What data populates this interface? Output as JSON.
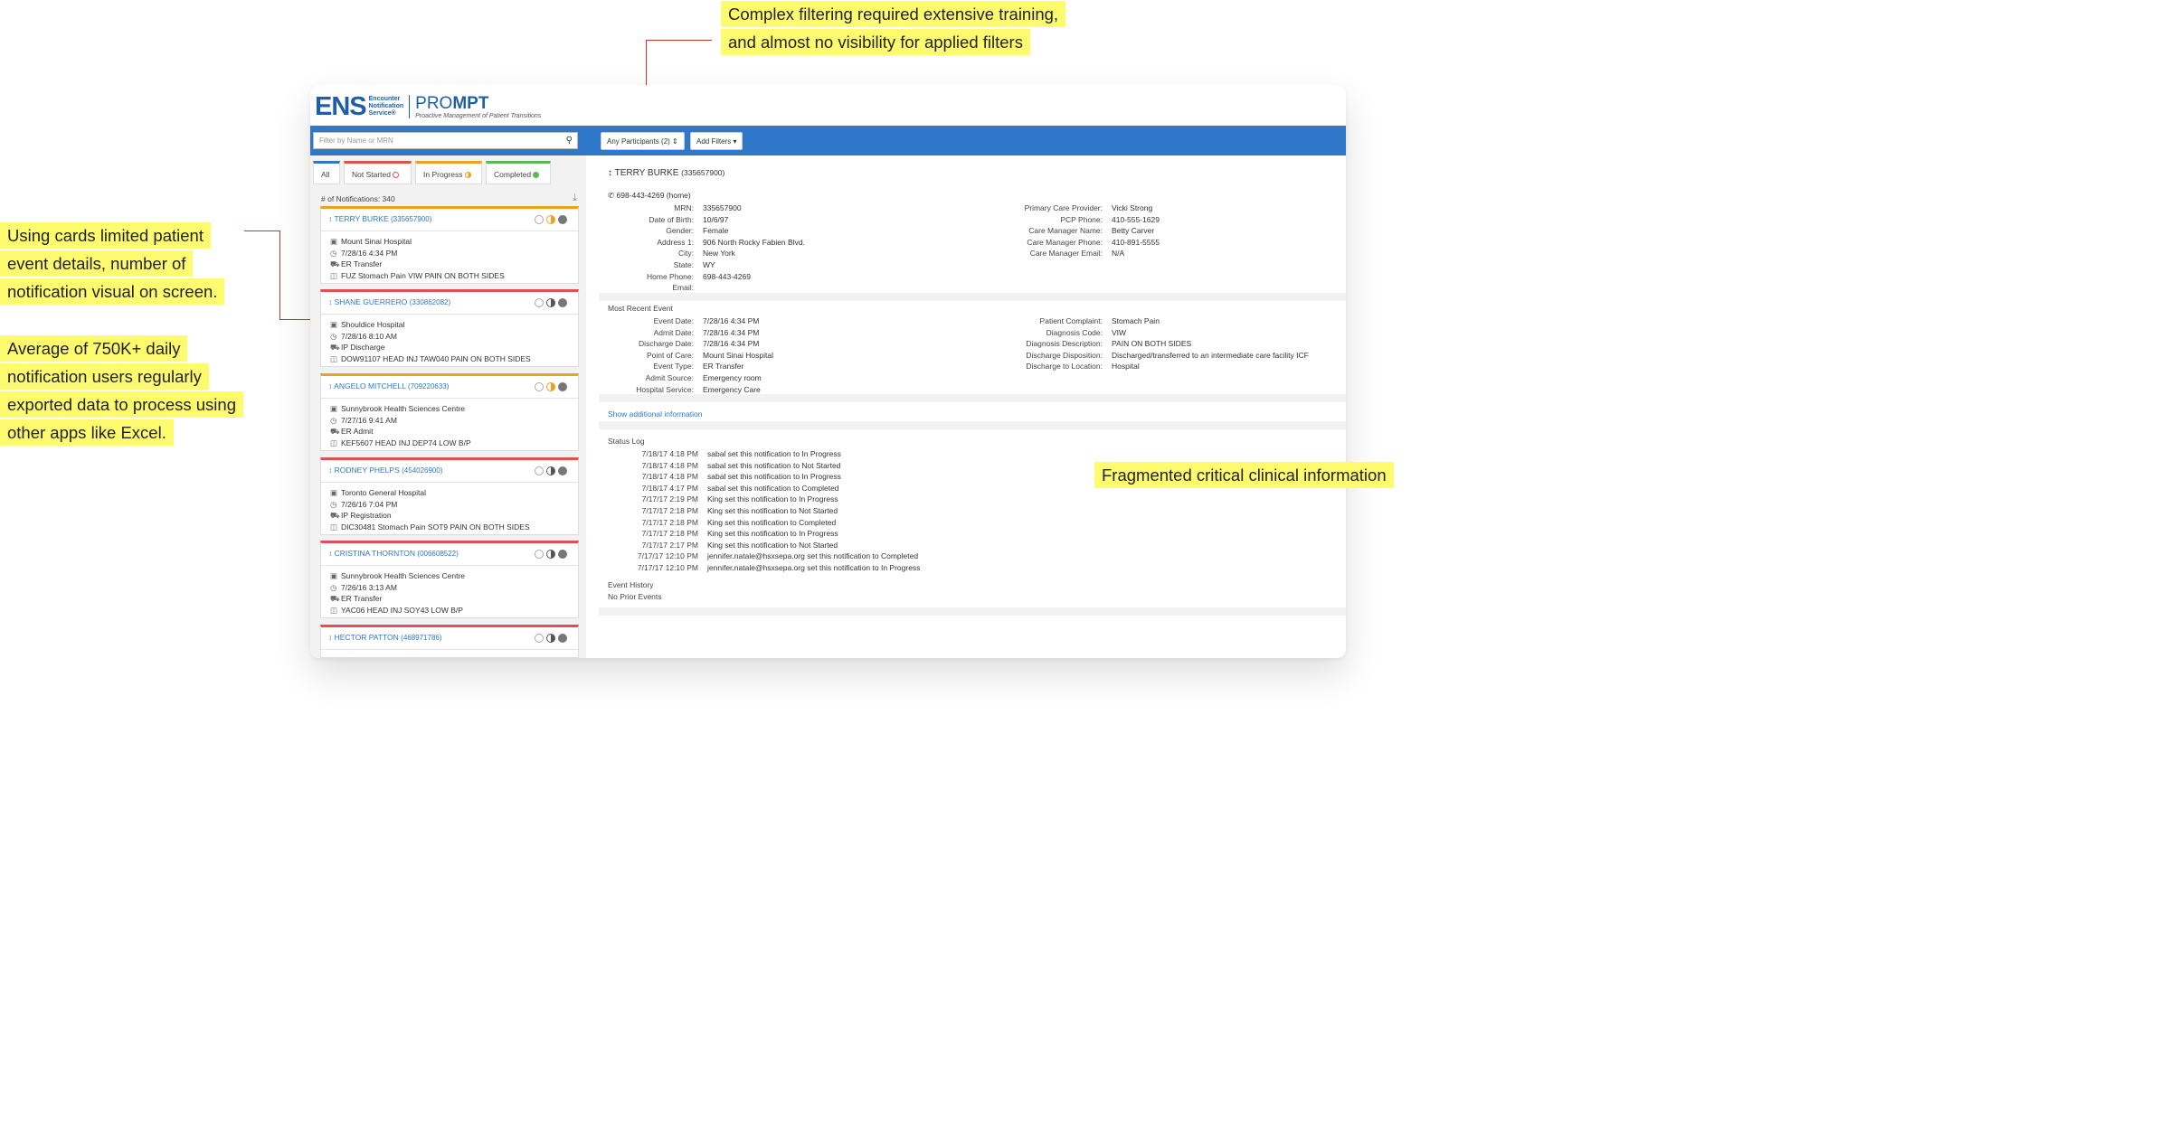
{
  "annotations": {
    "top_line1": "Complex filtering required extensive training,",
    "top_line2": "and almost no visibility for applied filters",
    "left_a1": "Using cards limited patient",
    "left_a2": "event details, number of",
    "left_a3": "notification visual on screen.",
    "left_b1": "Average of 750K+ daily",
    "left_b2": "notification users regularly",
    "left_b3": "exported data to process using",
    "left_b4": "other apps like Excel.",
    "right": "Fragmented critical clinical information"
  },
  "brand": {
    "ens": "ENS",
    "ens_sub1": "Encounter",
    "ens_sub2": "Notification",
    "ens_sub3": "Service®",
    "prompt_a": "PRO",
    "prompt_b": "MPT",
    "prompt_sub": "Proactive Management of Patient Transitions"
  },
  "toolbar": {
    "search_placeholder": "Filter by Name or MRN",
    "participants": "Any Participants (2) ⇕",
    "add_filters": "Add Filters ▾"
  },
  "tabs": [
    {
      "label": "All"
    },
    {
      "label": "Not Started"
    },
    {
      "label": "In Progress"
    },
    {
      "label": "Completed"
    }
  ],
  "notifications_count": "# of Notifications: 340",
  "colors": {
    "accent": "#2f78c9",
    "not_started": "#e05050",
    "in_progress": "#f0a020",
    "completed": "#5cb85c",
    "highlight": "#fffb6f",
    "callout": "#c0392b"
  },
  "cards": [
    {
      "name": "TERRY BURKE",
      "mrn": "(335657900)",
      "facility": "Mount Sinai Hospital",
      "time": "7/28/16 4:34 PM",
      "type": "ER Transfer",
      "dx": "FUZ Stomach Pain VIW PAIN ON BOTH SIDES",
      "status": "in-progress"
    },
    {
      "name": "SHANE GUERRERO",
      "mrn": "(330862082)",
      "facility": "Shouldice Hospital",
      "time": "7/28/16 8:10 AM",
      "type": "IP Discharge",
      "dx": "DOW91107 HEAD INJ TAW040 PAIN ON BOTH SIDES",
      "status": "not-started"
    },
    {
      "name": "ANGELO MITCHELL",
      "mrn": "(709220633)",
      "facility": "Sunnybrook Health Sciences Centre",
      "time": "7/27/16 9:41 AM",
      "type": "ER Admit",
      "dx": "KEF5607 HEAD INJ DEP74 LOW B/P",
      "status": "in-progress"
    },
    {
      "name": "RODNEY PHELPS",
      "mrn": "(454026900)",
      "facility": "Toronto General Hospital",
      "time": "7/26/16 7:04 PM",
      "type": "IP Registration",
      "dx": "DIC30481 Stomach Pain SOT9 PAIN ON BOTH SIDES",
      "status": "not-started"
    },
    {
      "name": "CRISTINA THORNTON",
      "mrn": "(006608522)",
      "facility": "Sunnybrook Health Sciences Centre",
      "time": "7/26/16 3:13 AM",
      "type": "ER Transfer",
      "dx": "YAC06 HEAD INJ SOY43 LOW B/P",
      "status": "not-started"
    },
    {
      "name": "HECTOR PATTON",
      "mrn": "(468971786)",
      "facility": "",
      "time": "",
      "type": "",
      "dx": "",
      "status": "not-started"
    }
  ],
  "patient": {
    "name": "TERRY BURKE",
    "mrn": "(335657900)",
    "phone": "698-443-4269 (home)",
    "demographics": [
      {
        "k": "MRN:",
        "v": "335657900"
      },
      {
        "k": "Date of Birth:",
        "v": "10/6/97"
      },
      {
        "k": "Gender:",
        "v": "Female"
      },
      {
        "k": "Address 1:",
        "v": "906 North Rocky Fabien Blvd."
      },
      {
        "k": "City:",
        "v": "New York"
      },
      {
        "k": "State:",
        "v": "WY"
      },
      {
        "k": "Home Phone:",
        "v": "698-443-4269"
      },
      {
        "k": "Email:",
        "v": ""
      }
    ],
    "care": [
      {
        "k": "Primary Care Provider:",
        "v": "Vicki Strong"
      },
      {
        "k": "PCP Phone:",
        "v": "410-555-1629"
      },
      {
        "k": "Care Manager Name:",
        "v": "Betty Carver"
      },
      {
        "k": "Care Manager Phone:",
        "v": "410-891-5555"
      },
      {
        "k": "Care Manager Email:",
        "v": "N/A"
      }
    ]
  },
  "event": {
    "title": "Most Recent Event",
    "left": [
      {
        "k": "Event Date:",
        "v": "7/28/16 4:34 PM"
      },
      {
        "k": "Admit Date:",
        "v": "7/28/16 4:34 PM"
      },
      {
        "k": "Discharge Date:",
        "v": "7/28/16 4:34 PM"
      },
      {
        "k": "Point of Care:",
        "v": "Mount Sinai Hospital"
      },
      {
        "k": "Event Type:",
        "v": "ER Transfer"
      },
      {
        "k": "Admit Source:",
        "v": "Emergency room"
      },
      {
        "k": "Hospital Service:",
        "v": "Emergency Care"
      }
    ],
    "right": [
      {
        "k": "Patient Complaint:",
        "v": "Stomach Pain"
      },
      {
        "k": "Diagnosis Code:",
        "v": "VIW"
      },
      {
        "k": "Diagnosis Description:",
        "v": "PAIN ON BOTH SIDES"
      },
      {
        "k": "Discharge Disposition:",
        "v": "Discharged/transferred to an intermediate care facility ICF"
      },
      {
        "k": "Discharge to Location:",
        "v": "Hospital"
      }
    ]
  },
  "show_more": "Show additional information",
  "status_log": {
    "title": "Status Log",
    "rows": [
      {
        "k": "7/18/17 4:18 PM",
        "v": "sabal set this notification to In Progress"
      },
      {
        "k": "7/18/17 4:18 PM",
        "v": "sabal set this notification to Not Started"
      },
      {
        "k": "7/18/17 4:18 PM",
        "v": "sabal set this notification to In Progress"
      },
      {
        "k": "7/18/17 4:17 PM",
        "v": "sabal set this notification to Completed"
      },
      {
        "k": "7/17/17 2:19 PM",
        "v": "King set this notification to In Progress"
      },
      {
        "k": "7/17/17 2:18 PM",
        "v": "King set this notification to Not Started"
      },
      {
        "k": "7/17/17 2:18 PM",
        "v": "King set this notification to Completed"
      },
      {
        "k": "7/17/17 2:18 PM",
        "v": "King set this notification to In Progress"
      },
      {
        "k": "7/17/17 2:17 PM",
        "v": "King set this notification to Not Started"
      },
      {
        "k": "7/17/17 12:10 PM",
        "v": "jennifer.natale@hsxsepa.org set this notification to Completed"
      },
      {
        "k": "7/17/17 12:10 PM",
        "v": "jennifer.natale@hsxsepa.org set this notification to In Progress"
      }
    ]
  },
  "event_history": {
    "title": "Event History",
    "value": "No Prior Events"
  }
}
